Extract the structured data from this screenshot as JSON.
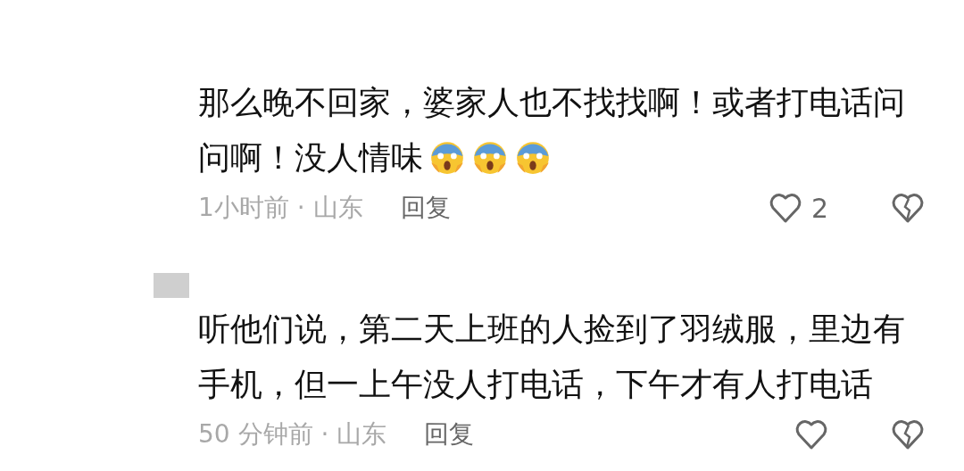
{
  "comments": [
    {
      "avatar": false,
      "lines": [
        "那么晚不回家，婆家人也不找找啊！或者打电话问",
        "问啊！没人情味"
      ],
      "emojis": [
        {
          "kind": "scream"
        },
        {
          "kind": "scream"
        },
        {
          "kind": "scream"
        }
      ],
      "time": "1小时前 · 山东",
      "reply": "回复",
      "likes": "2"
    },
    {
      "avatar": true,
      "lines": [
        "听他们说，第二天上班的人捡到了羽绒服，里边有",
        "手机，但一上午没人打电话，下午才有人打电话"
      ],
      "time": "50 分钟前 · 山东",
      "reply": "回复"
    }
  ]
}
